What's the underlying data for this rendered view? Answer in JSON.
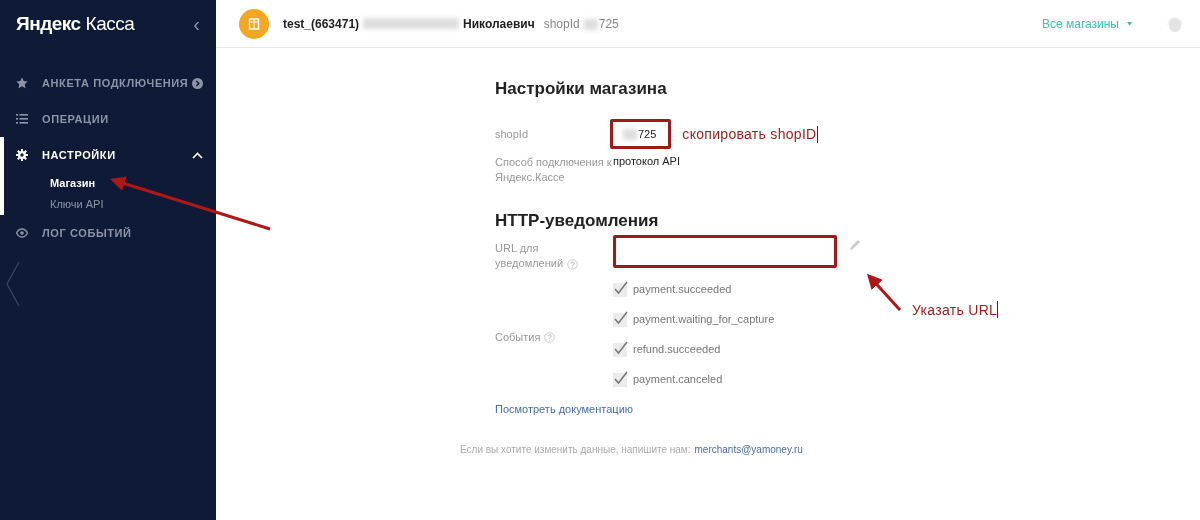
{
  "sidebar": {
    "logo_bold": "Яндекс",
    "logo_light": "Касса",
    "collapse": "‹",
    "items": [
      {
        "label": "АНКЕТА ПОДКЛЮЧЕНИЯ",
        "selected": false
      },
      {
        "label": "ОПЕРАЦИИ",
        "selected": false
      },
      {
        "label": "НАСТРОЙКИ",
        "selected": true,
        "expanded": true,
        "children": [
          {
            "label": "Магазин",
            "selected": true
          },
          {
            "label": "Ключи API",
            "selected": false
          }
        ]
      },
      {
        "label": "ЛОГ СОБЫТИЙ",
        "selected": false
      }
    ]
  },
  "header": {
    "shop": "test_(663471)",
    "owner": "Николаевич",
    "shopid_label": "shopId",
    "shopid_value": "725",
    "stores": "Все магазины"
  },
  "settings": {
    "title": "Настройки магазина",
    "fields": [
      {
        "label": "shopId",
        "value": "725"
      },
      {
        "label": "Способ подключения к Яндекс.Кассе",
        "value": "протокол API"
      }
    ]
  },
  "notifications": {
    "title": "HTTP-уведомления",
    "url_label": "URL для уведомлений",
    "events_label": "События",
    "events": [
      {
        "label": "payment.succeeded",
        "checked": true
      },
      {
        "label": "payment.waiting_for_capture",
        "checked": true
      },
      {
        "label": "refund.succeeded",
        "checked": true
      },
      {
        "label": "payment.canceled",
        "checked": true
      }
    ],
    "docs_link": "Посмотреть документацию"
  },
  "footer": {
    "text": "Если вы хотите изменить данные, напишите нам:",
    "email": "merchants@yamoney.ru"
  },
  "annotations": {
    "copy_note": "скопировать shopID",
    "url_note": "Указать URL"
  }
}
